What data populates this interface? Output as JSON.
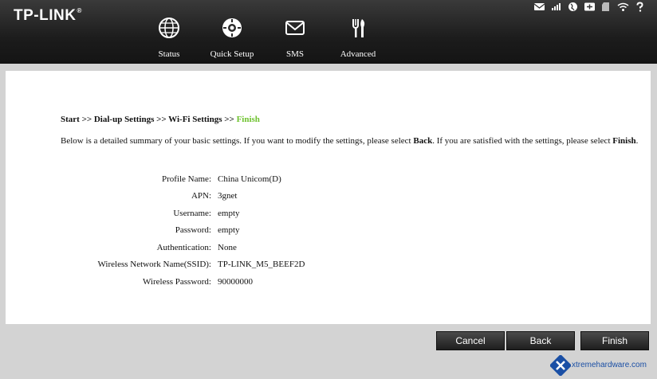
{
  "brand": {
    "logo_text": "TP-LINK",
    "logo_reg": "®"
  },
  "nav": {
    "status": "Status",
    "quick_setup": "Quick Setup",
    "sms": "SMS",
    "advanced": "Advanced"
  },
  "breadcrumb": {
    "steps": "Start >> Dial-up Settings >> Wi-Fi Settings >> ",
    "current": "Finish"
  },
  "intro": {
    "part1": "Below is a detailed summary of your basic settings. If you want to modify the settings, please select ",
    "back_word": "Back",
    "part2": ". If you are satisfied with the settings, please select ",
    "finish_word": "Finish",
    "part3": "."
  },
  "summary": {
    "profile_name": {
      "label": "Profile Name:",
      "value": "China Unicom(D)"
    },
    "apn": {
      "label": "APN:",
      "value": "3gnet"
    },
    "username": {
      "label": "Username:",
      "value": "empty"
    },
    "password": {
      "label": "Password:",
      "value": "empty"
    },
    "authentication": {
      "label": "Authentication:",
      "value": "None"
    },
    "ssid": {
      "label": "Wireless Network Name(SSID):",
      "value": "TP-LINK_M5_BEEF2D"
    },
    "wireless_password": {
      "label": "Wireless Password:",
      "value": "90000000"
    }
  },
  "buttons": {
    "cancel": "Cancel",
    "back": "Back",
    "finish": "Finish"
  },
  "watermark": "xtremehardware.com",
  "colors": {
    "accent_green": "#6ec22e",
    "header_dark": "#1c1c1c",
    "panel_bg": "#ffffff"
  }
}
